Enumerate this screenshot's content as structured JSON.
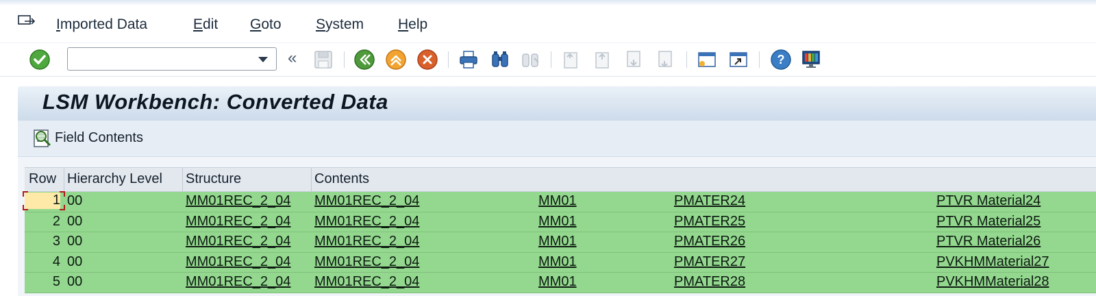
{
  "menubar": {
    "items": [
      {
        "mnemonic": "I",
        "rest": "mported Data"
      },
      {
        "mnemonic": "E",
        "rest": "dit"
      },
      {
        "mnemonic": "G",
        "rest": "oto"
      },
      {
        "mnemonic": "S",
        "rest": "ystem"
      },
      {
        "mnemonic": "H",
        "rest": "elp"
      }
    ]
  },
  "toolbar": {
    "command_value": "",
    "chevron": "«"
  },
  "title": "LSM Workbench: Converted Data",
  "app_toolbar": {
    "field_contents_label": "Field Contents"
  },
  "table": {
    "headers": [
      "Row",
      "Hierarchy Level",
      "Structure",
      "Contents"
    ],
    "rows": [
      {
        "row": "1",
        "level": "00",
        "structure": "MM01REC_2_04",
        "c1": "MM01REC_2_04",
        "c2": "MM01",
        "c3": "PMATER24",
        "c4": "PTVR Material24"
      },
      {
        "row": "2",
        "level": "00",
        "structure": "MM01REC_2_04",
        "c1": "MM01REC_2_04",
        "c2": "MM01",
        "c3": "PMATER25",
        "c4": "PTVR Material25"
      },
      {
        "row": "3",
        "level": "00",
        "structure": "MM01REC_2_04",
        "c1": "MM01REC_2_04",
        "c2": "MM01",
        "c3": "PMATER26",
        "c4": "PTVR Material26"
      },
      {
        "row": "4",
        "level": "00",
        "structure": "MM01REC_2_04",
        "c1": "MM01REC_2_04",
        "c2": "MM01",
        "c3": "PMATER27",
        "c4": "PVKHMMaterial27"
      },
      {
        "row": "5",
        "level": "00",
        "structure": "MM01REC_2_04",
        "c1": "MM01REC_2_04",
        "c2": "MM01",
        "c3": "PMATER28",
        "c4": "PVKHMMaterial28"
      }
    ]
  }
}
